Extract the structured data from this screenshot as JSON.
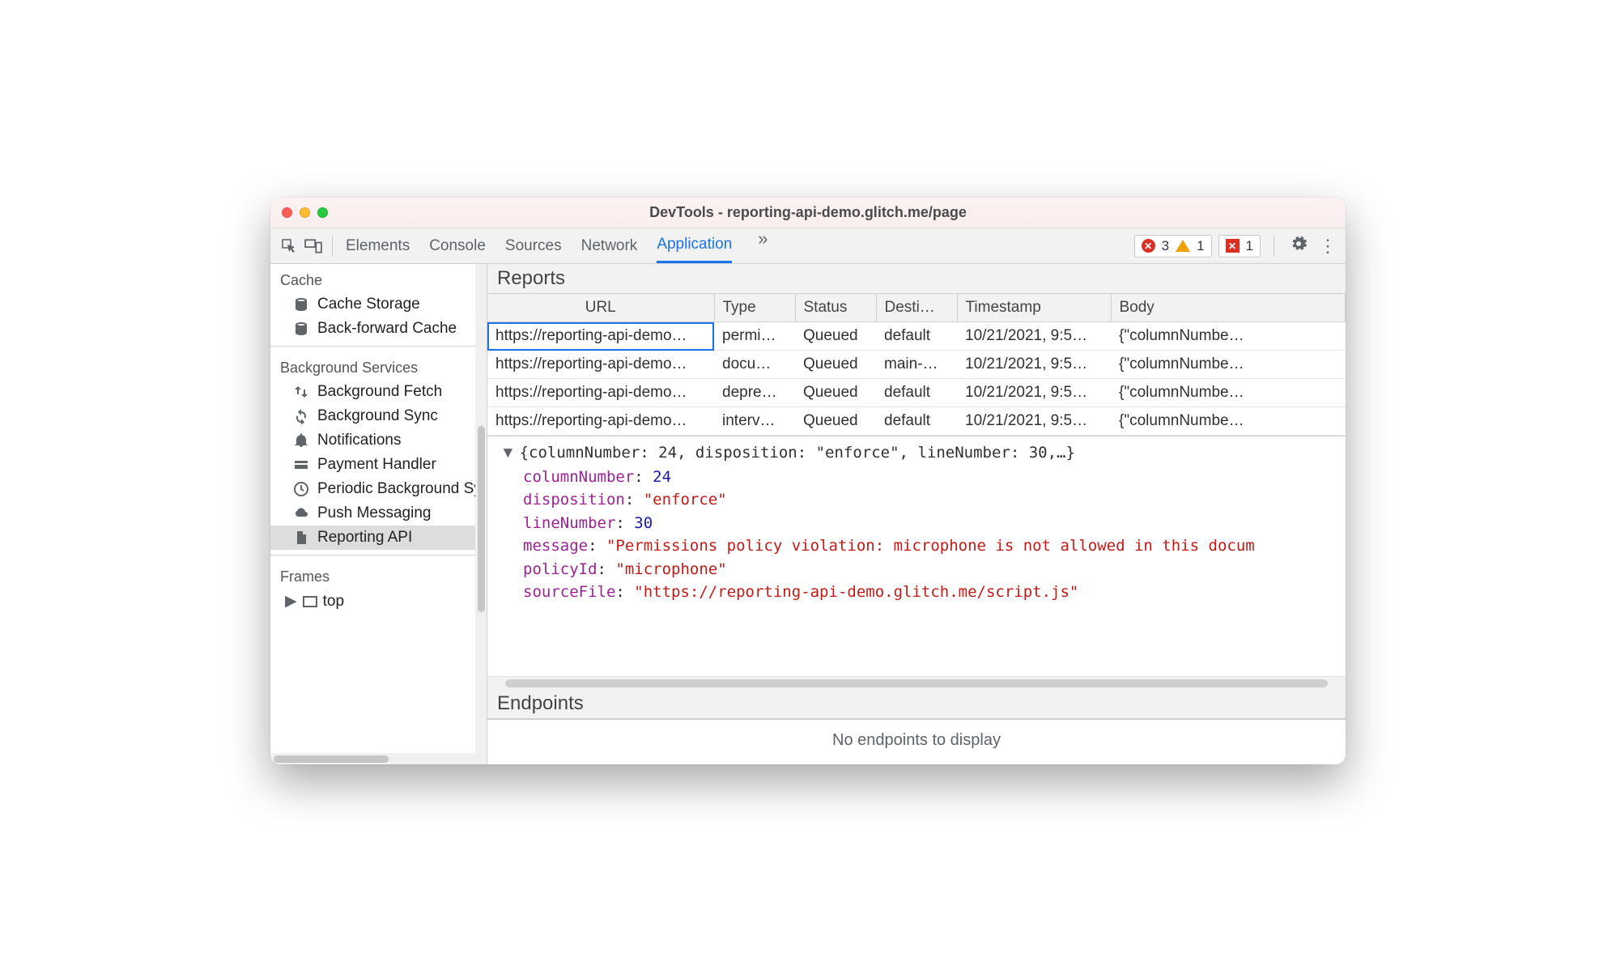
{
  "window": {
    "title": "DevTools - reporting-api-demo.glitch.me/page"
  },
  "toolbar": {
    "tabs": [
      "Elements",
      "Console",
      "Sources",
      "Network",
      "Application"
    ],
    "active_tab": "Application",
    "overflow_glyph": "»",
    "errors_count": "3",
    "warnings_count": "1",
    "issues_count": "1"
  },
  "sidebar": {
    "sections": [
      {
        "heading": "Cache",
        "items": [
          {
            "id": "cache-storage",
            "label": "Cache Storage",
            "icon": "database"
          },
          {
            "id": "back-forward",
            "label": "Back-forward Cache",
            "icon": "database"
          }
        ]
      },
      {
        "heading": "Background Services",
        "items": [
          {
            "id": "bg-fetch",
            "label": "Background Fetch",
            "icon": "updown"
          },
          {
            "id": "bg-sync",
            "label": "Background Sync",
            "icon": "sync"
          },
          {
            "id": "notif",
            "label": "Notifications",
            "icon": "bell"
          },
          {
            "id": "pay",
            "label": "Payment Handler",
            "icon": "card"
          },
          {
            "id": "periodic",
            "label": "Periodic Background Sync",
            "icon": "clock"
          },
          {
            "id": "push",
            "label": "Push Messaging",
            "icon": "cloud"
          },
          {
            "id": "reporting",
            "label": "Reporting API",
            "icon": "doc",
            "selected": true
          }
        ]
      },
      {
        "heading": "Frames",
        "items": [
          {
            "id": "frame-top",
            "label": "top",
            "icon": "frame",
            "tree": true
          }
        ]
      }
    ]
  },
  "reports": {
    "heading": "Reports",
    "columns": [
      "URL",
      "Type",
      "Status",
      "Desti…",
      "Timestamp",
      "Body"
    ],
    "rows": [
      {
        "url": "https://reporting-api-demo…",
        "type": "permi…",
        "status": "Queued",
        "dest": "default",
        "ts": "10/21/2021, 9:5…",
        "body": "{\"columnNumbe…",
        "selected": true
      },
      {
        "url": "https://reporting-api-demo…",
        "type": "docu…",
        "status": "Queued",
        "dest": "main-…",
        "ts": "10/21/2021, 9:5…",
        "body": "{\"columnNumbe…"
      },
      {
        "url": "https://reporting-api-demo…",
        "type": "depre…",
        "status": "Queued",
        "dest": "default",
        "ts": "10/21/2021, 9:5…",
        "body": "{\"columnNumbe…"
      },
      {
        "url": "https://reporting-api-demo…",
        "type": "interv…",
        "status": "Queued",
        "dest": "default",
        "ts": "10/21/2021, 9:5…",
        "body": "{\"columnNumbe…"
      }
    ]
  },
  "detail": {
    "summary": "{columnNumber: 24, disposition: \"enforce\", lineNumber: 30,…}",
    "props": [
      {
        "k": "columnNumber",
        "v": "24",
        "t": "num"
      },
      {
        "k": "disposition",
        "v": "\"enforce\"",
        "t": "str"
      },
      {
        "k": "lineNumber",
        "v": "30",
        "t": "num"
      },
      {
        "k": "message",
        "v": "\"Permissions policy violation: microphone is not allowed in this docum",
        "t": "str"
      },
      {
        "k": "policyId",
        "v": "\"microphone\"",
        "t": "str"
      },
      {
        "k": "sourceFile",
        "v": "\"https://reporting-api-demo.glitch.me/script.js\"",
        "t": "str"
      }
    ]
  },
  "endpoints": {
    "heading": "Endpoints",
    "empty": "No endpoints to display"
  }
}
